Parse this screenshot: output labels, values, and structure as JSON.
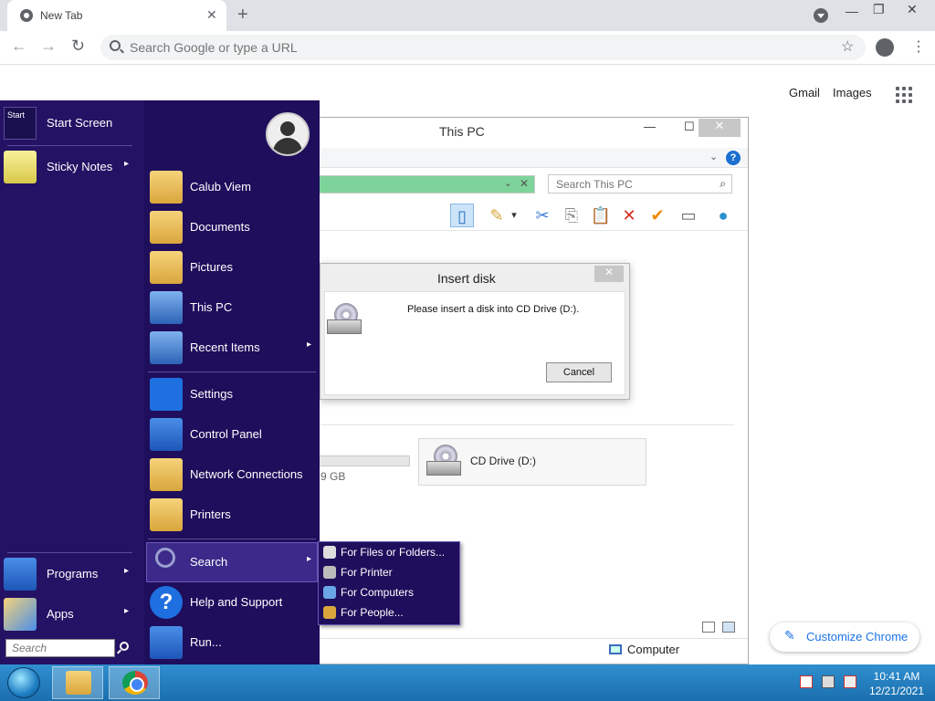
{
  "chrome": {
    "tab_title": "New Tab",
    "tab_close": "✕",
    "new_tab": "+",
    "win_minimize": "—",
    "win_restore": "❐",
    "win_close": "✕",
    "back": "←",
    "forward": "→",
    "reload": "↻",
    "omnibox_placeholder": "Search Google or type a URL",
    "star": "☆",
    "menu": "⋮",
    "gmail": "Gmail",
    "images": "Images",
    "customize": "Customize Chrome",
    "customize_icon": "✎"
  },
  "explorer": {
    "title": "This PC",
    "minimize": "—",
    "maximize": "☐",
    "close": "✕",
    "help": "?",
    "expand": "⌄",
    "address_dropdown": "⌄",
    "address_clear": "✕",
    "search_placeholder": "Search This PC",
    "search_icon": "⌕",
    "tools": [
      "▯",
      "✎",
      "▾",
      "✂",
      "⎘",
      "📋",
      "✕",
      "✔",
      "▭",
      "●"
    ],
    "gb_text": "9 GB",
    "drive_label": "CD Drive (D:)",
    "status_computer": "Computer"
  },
  "dialog": {
    "title": "Insert disk",
    "close": "✕",
    "message": "Please insert a disk into CD Drive (D:).",
    "cancel": "Cancel"
  },
  "start_menu": {
    "start_tile": "Start",
    "left_items": [
      {
        "label": "Start Screen"
      },
      {
        "label": "Sticky Notes",
        "arrow": "▸"
      },
      {
        "label": "Programs",
        "arrow": "▸"
      },
      {
        "label": "Apps",
        "arrow": "▸"
      }
    ],
    "right_items": [
      {
        "label": "Calub Viem"
      },
      {
        "label": "Documents"
      },
      {
        "label": "Pictures"
      },
      {
        "label": "This PC"
      },
      {
        "label": "Recent Items",
        "arrow": "▸"
      },
      {
        "label": "Settings"
      },
      {
        "label": "Control Panel"
      },
      {
        "label": "Network Connections"
      },
      {
        "label": "Printers"
      },
      {
        "label": "Search",
        "arrow": "▸"
      },
      {
        "label": "Help and Support"
      },
      {
        "label": "Run..."
      }
    ],
    "help_glyph": "?",
    "search_placeholder": "Search",
    "search_submenu": [
      {
        "label": "For Files or Folders..."
      },
      {
        "label": "For Printer"
      },
      {
        "label": "For Computers"
      },
      {
        "label": "For People..."
      }
    ]
  },
  "taskbar": {
    "time": "10:41 AM",
    "date": "12/21/2021"
  },
  "colors": {
    "start_menu_bg": "#1e0e5c",
    "taskbar": "#2f8fcf",
    "address_bar_green": "#7ed39a",
    "chrome_accent": "#1a73e8"
  }
}
